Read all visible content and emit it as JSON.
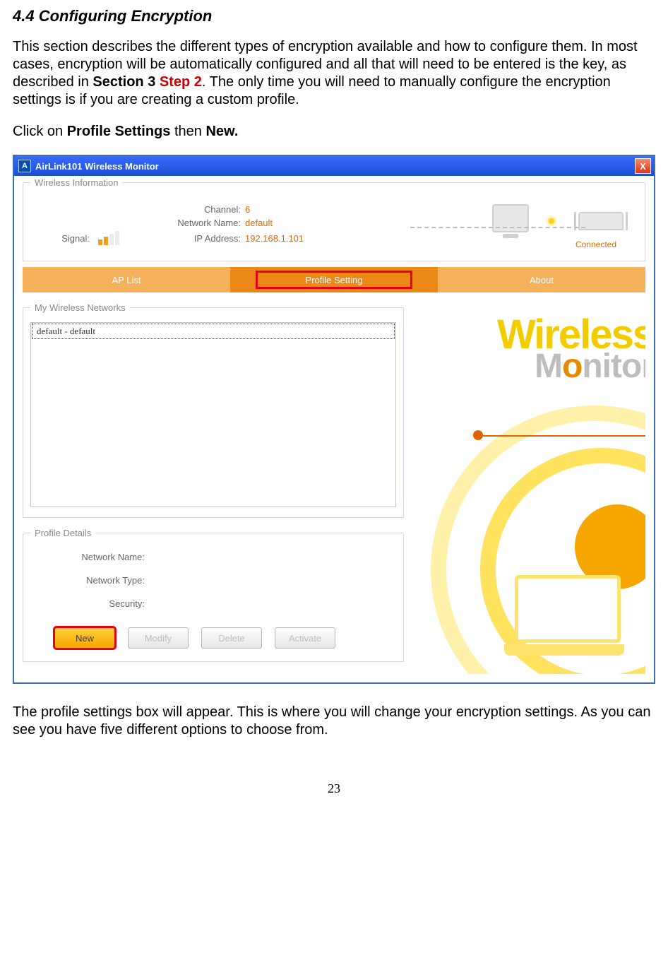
{
  "heading": "4.4 Configuring Encryption",
  "p1_a": "This section describes the different types of encryption available and how to configure them.  In most cases, encryption will be automatically configured and all that will need to be entered is the key, as described in ",
  "p1_b_bold": "Section 3 ",
  "p1_b_red": "Step 2",
  "p1_c": ".  The only time you will need to manually configure the encryption settings is if you are creating a custom profile.",
  "p2_a": "Click on ",
  "p2_b": "Profile Settings",
  "p2_c": " then ",
  "p2_d": "New.",
  "p3": "The profile settings box will appear.  This is where you will change your encryption settings.  As you can see you have five different options to choose from.",
  "pagenum": "23",
  "win": {
    "title": "AirLink101 Wireless Monitor",
    "close": "X",
    "group_wireless": "Wireless Information",
    "signal_label": "Signal:",
    "channel_label": "Channel:",
    "channel_value": "6",
    "netname_label": "Network Name:",
    "netname_value": "default",
    "ip_label": "IP Address:",
    "ip_value": "192.168.1.101",
    "connected": "Connected",
    "tab_ap": "AP List",
    "tab_profile": "Profile Setting",
    "tab_about": "About",
    "group_mynets": "My Wireless Networks",
    "list_item0": "default - default",
    "group_details": "Profile Details",
    "det_netname": "Network Name:",
    "det_nettype": "Network Type:",
    "det_security": "Security:",
    "btn_new": "New",
    "btn_modify": "Modify",
    "btn_delete": "Delete",
    "btn_activate": "Activate",
    "logo_word1": "Wireless",
    "logo_m_pre": "M",
    "logo_m_o": "o",
    "logo_m_post": "nitor"
  }
}
